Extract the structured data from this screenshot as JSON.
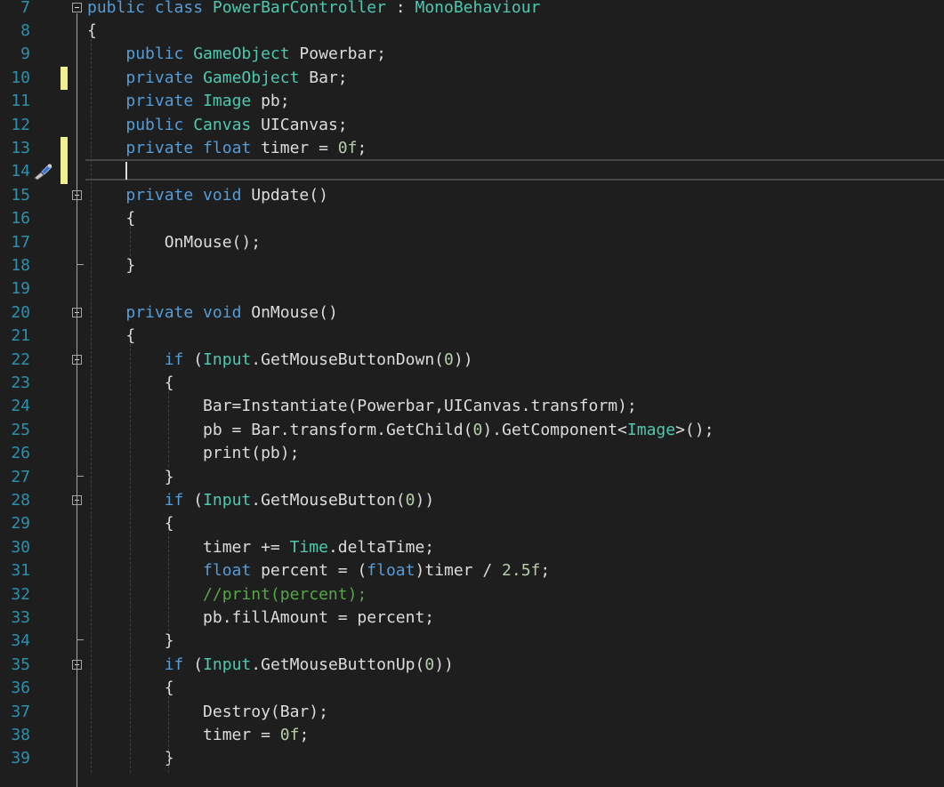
{
  "editor": {
    "lines": [
      {
        "n": "7",
        "fold": true,
        "changed": false,
        "tokens": [
          [
            "kw",
            "public class "
          ],
          [
            "ty",
            "PowerBarController"
          ],
          [
            "pl",
            " : "
          ],
          [
            "ty",
            "MonoBehaviour"
          ]
        ]
      },
      {
        "n": "8",
        "fold": false,
        "changed": false,
        "tokens": [
          [
            "pl",
            "{"
          ]
        ]
      },
      {
        "n": "9",
        "fold": false,
        "changed": false,
        "tokens": [
          [
            "pl",
            "    "
          ],
          [
            "kw",
            "public "
          ],
          [
            "ty",
            "GameObject"
          ],
          [
            "pl",
            " Powerbar;"
          ]
        ]
      },
      {
        "n": "10",
        "fold": false,
        "changed": true,
        "tokens": [
          [
            "pl",
            "    "
          ],
          [
            "kw",
            "private "
          ],
          [
            "ty",
            "GameObject"
          ],
          [
            "pl",
            " Bar;"
          ]
        ]
      },
      {
        "n": "11",
        "fold": false,
        "changed": false,
        "tokens": [
          [
            "pl",
            "    "
          ],
          [
            "kw",
            "private "
          ],
          [
            "ty",
            "Image"
          ],
          [
            "pl",
            " pb;"
          ]
        ]
      },
      {
        "n": "12",
        "fold": false,
        "changed": false,
        "tokens": [
          [
            "pl",
            "    "
          ],
          [
            "kw",
            "public "
          ],
          [
            "ty",
            "Canvas"
          ],
          [
            "pl",
            " UICanvas;"
          ]
        ]
      },
      {
        "n": "13",
        "fold": false,
        "changed": true,
        "tokens": [
          [
            "pl",
            "    "
          ],
          [
            "kw",
            "private float"
          ],
          [
            "pl",
            " timer = "
          ],
          [
            "num",
            "0f"
          ],
          [
            "pl",
            ";"
          ]
        ]
      },
      {
        "n": "14",
        "fold": false,
        "changed": true,
        "tokens": []
      },
      {
        "n": "15",
        "fold": true,
        "changed": false,
        "tokens": [
          [
            "pl",
            "    "
          ],
          [
            "kw",
            "private void"
          ],
          [
            "pl",
            " Update()"
          ]
        ]
      },
      {
        "n": "16",
        "fold": false,
        "changed": false,
        "tokens": [
          [
            "pl",
            "    {"
          ]
        ]
      },
      {
        "n": "17",
        "fold": false,
        "changed": false,
        "tokens": [
          [
            "pl",
            "        OnMouse();"
          ]
        ]
      },
      {
        "n": "18",
        "fold": false,
        "changed": false,
        "tokens": [
          [
            "pl",
            "    }"
          ]
        ]
      },
      {
        "n": "19",
        "fold": false,
        "changed": false,
        "tokens": []
      },
      {
        "n": "20",
        "fold": true,
        "changed": false,
        "tokens": [
          [
            "pl",
            "    "
          ],
          [
            "kw",
            "private void"
          ],
          [
            "pl",
            " OnMouse()"
          ]
        ]
      },
      {
        "n": "21",
        "fold": false,
        "changed": false,
        "tokens": [
          [
            "pl",
            "    {"
          ]
        ]
      },
      {
        "n": "22",
        "fold": true,
        "changed": false,
        "tokens": [
          [
            "pl",
            "        "
          ],
          [
            "kw",
            "if"
          ],
          [
            "pl",
            " ("
          ],
          [
            "ty",
            "Input"
          ],
          [
            "pl",
            ".GetMouseButtonDown("
          ],
          [
            "num",
            "0"
          ],
          [
            "pl",
            "))"
          ]
        ]
      },
      {
        "n": "23",
        "fold": false,
        "changed": false,
        "tokens": [
          [
            "pl",
            "        {"
          ]
        ]
      },
      {
        "n": "24",
        "fold": false,
        "changed": false,
        "tokens": [
          [
            "pl",
            "            Bar=Instantiate(Powerbar,UICanvas.transform);"
          ]
        ]
      },
      {
        "n": "25",
        "fold": false,
        "changed": false,
        "tokens": [
          [
            "pl",
            "            pb = Bar.transform.GetChild("
          ],
          [
            "num",
            "0"
          ],
          [
            "pl",
            ").GetComponent<"
          ],
          [
            "ty",
            "Image"
          ],
          [
            "pl",
            ">();"
          ]
        ]
      },
      {
        "n": "26",
        "fold": false,
        "changed": false,
        "tokens": [
          [
            "pl",
            "            print(pb);"
          ]
        ]
      },
      {
        "n": "27",
        "fold": false,
        "changed": false,
        "tokens": [
          [
            "pl",
            "        }"
          ]
        ]
      },
      {
        "n": "28",
        "fold": true,
        "changed": false,
        "tokens": [
          [
            "pl",
            "        "
          ],
          [
            "kw",
            "if"
          ],
          [
            "pl",
            " ("
          ],
          [
            "ty",
            "Input"
          ],
          [
            "pl",
            ".GetMouseButton("
          ],
          [
            "num",
            "0"
          ],
          [
            "pl",
            "))"
          ]
        ]
      },
      {
        "n": "29",
        "fold": false,
        "changed": false,
        "tokens": [
          [
            "pl",
            "        {"
          ]
        ]
      },
      {
        "n": "30",
        "fold": false,
        "changed": false,
        "tokens": [
          [
            "pl",
            "            timer += "
          ],
          [
            "ty",
            "Time"
          ],
          [
            "pl",
            ".deltaTime;"
          ]
        ]
      },
      {
        "n": "31",
        "fold": false,
        "changed": false,
        "tokens": [
          [
            "pl",
            "            "
          ],
          [
            "kw",
            "float"
          ],
          [
            "pl",
            " percent = ("
          ],
          [
            "kw",
            "float"
          ],
          [
            "pl",
            ")timer / "
          ],
          [
            "num",
            "2.5f"
          ],
          [
            "pl",
            ";"
          ]
        ]
      },
      {
        "n": "32",
        "fold": false,
        "changed": false,
        "tokens": [
          [
            "pl",
            "            "
          ],
          [
            "cm",
            "//print(percent);"
          ]
        ]
      },
      {
        "n": "33",
        "fold": false,
        "changed": false,
        "tokens": [
          [
            "pl",
            "            pb.fillAmount = percent;"
          ]
        ]
      },
      {
        "n": "34",
        "fold": false,
        "changed": false,
        "tokens": [
          [
            "pl",
            "        }"
          ]
        ]
      },
      {
        "n": "35",
        "fold": true,
        "changed": false,
        "tokens": [
          [
            "pl",
            "        "
          ],
          [
            "kw",
            "if"
          ],
          [
            "pl",
            " ("
          ],
          [
            "ty",
            "Input"
          ],
          [
            "pl",
            ".GetMouseButtonUp("
          ],
          [
            "num",
            "0"
          ],
          [
            "pl",
            "))"
          ]
        ]
      },
      {
        "n": "36",
        "fold": false,
        "changed": false,
        "tokens": [
          [
            "pl",
            "        {"
          ]
        ]
      },
      {
        "n": "37",
        "fold": false,
        "changed": false,
        "tokens": [
          [
            "pl",
            "            Destroy(Bar);"
          ]
        ]
      },
      {
        "n": "38",
        "fold": false,
        "changed": false,
        "tokens": [
          [
            "pl",
            "            timer = "
          ],
          [
            "num",
            "0f"
          ],
          [
            "pl",
            ";"
          ]
        ]
      },
      {
        "n": "39",
        "fold": false,
        "changed": false,
        "tokens": [
          [
            "pl",
            "        }"
          ]
        ]
      }
    ],
    "colors": {
      "background": "#1e1e1e",
      "line_number": "#2b91af",
      "keyword": "#569cd6",
      "type": "#4ec9b0",
      "number": "#b5cea8",
      "comment": "#57a64a",
      "plain": "#dcdcdc",
      "change_marker": "#efef91"
    },
    "current_line": "14",
    "gutter_icon": "quick-action-brush-icon"
  }
}
